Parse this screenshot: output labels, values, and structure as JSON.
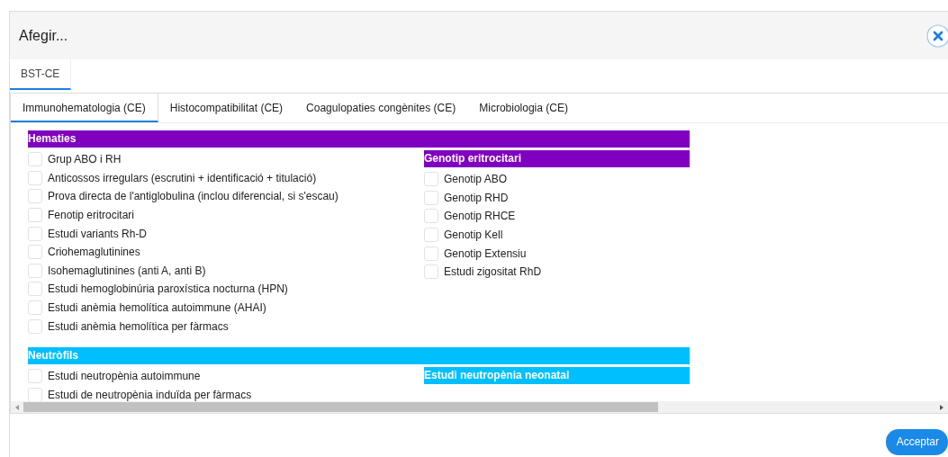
{
  "dialog": {
    "title": "Afegir...",
    "footer_button": "Acceptar"
  },
  "outer_tabs": [
    {
      "label": "BST-CE",
      "selected": true
    }
  ],
  "inner_tabs": [
    {
      "label": "Immunohematologia (CE)",
      "selected": true
    },
    {
      "label": "Histocompatibilitat (CE)",
      "selected": false
    },
    {
      "label": "Coagulopaties congènites (CE)",
      "selected": false
    },
    {
      "label": "Microbiologia (CE)",
      "selected": false
    }
  ],
  "sections": [
    {
      "title": "Hematies",
      "color": "#8000c0",
      "items": [
        {
          "label": "Grup ABO i RH",
          "checked": false
        },
        {
          "label": "Anticossos irregulars (escrutini + identificació + titulació)",
          "checked": false
        },
        {
          "label": "Prova directa de l'antiglobulina (inclou diferencial, si s'escau)",
          "checked": false
        },
        {
          "label": "Fenotip eritrocitari",
          "checked": false
        },
        {
          "label": "Estudi variants Rh-D",
          "checked": false
        },
        {
          "label": "Criohemaglutinines",
          "checked": false
        },
        {
          "label": "Isohemaglutinines (anti A, anti B)",
          "checked": false
        },
        {
          "label": "Estudi hemoglobinúria paroxística nocturna (HPN)",
          "checked": false
        },
        {
          "label": "Estudi anèmia hemolítica autoimmune (AHAI)",
          "checked": false
        },
        {
          "label": "Estudi anèmia hemolítica per fàrmacs",
          "checked": false
        }
      ],
      "subgroup": {
        "title": "Genotip eritrocitari",
        "items": [
          {
            "label": "Genotip ABO",
            "checked": false
          },
          {
            "label": "Genotip RHD",
            "checked": false
          },
          {
            "label": "Genotip RHCE",
            "checked": false
          },
          {
            "label": "Genotip Kell",
            "checked": false
          },
          {
            "label": "Genotip Extensiu",
            "checked": false
          },
          {
            "label": "Estudi zigositat RhD",
            "checked": false
          }
        ]
      }
    },
    {
      "title": "Neutròfils",
      "color": "#00bfff",
      "items": [
        {
          "label": "Estudi neutropènia autoimmune",
          "checked": false
        },
        {
          "label": "Estudi de neutropènia induïda per fàrmacs",
          "checked": false
        }
      ],
      "subgroup": {
        "title": "Estudi neutropènia neonatal"
      }
    }
  ]
}
